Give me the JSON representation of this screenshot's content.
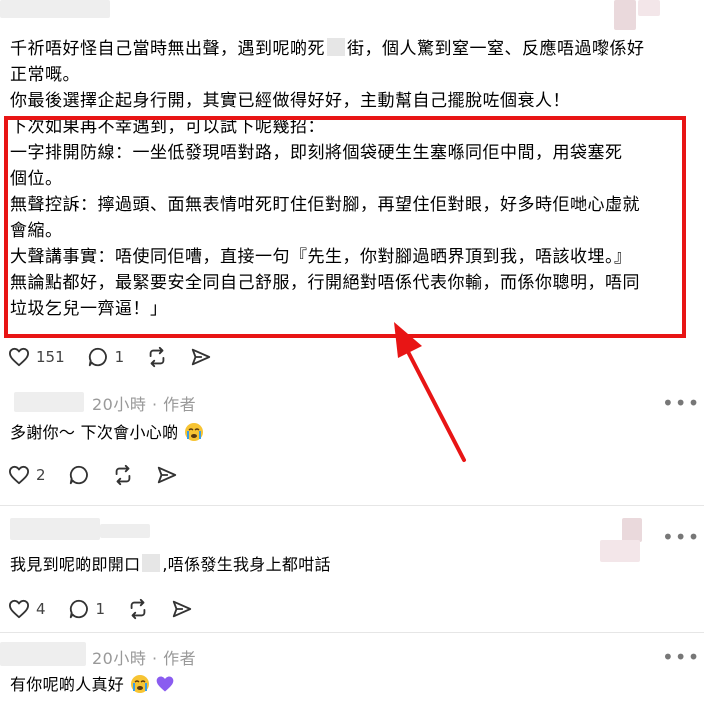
{
  "post": {
    "paragraph1": "千祈唔好怪自己當時無出聲，遇到呢啲死",
    "paragraph1b": "街，個人驚到窒一窒、反應唔過嚟係好",
    "paragraph1c": "正常嘅。",
    "paragraph2": "你最後選擇企起身行開，其實已經做得好好，主動幫自己擺脫咗個衰人！",
    "tips": [
      "下次如果再不幸遇到，可以試下呢幾招：",
      "一字排開防線：一坐低發現唔對路，即刻將個袋硬生生塞喺同佢中間，用袋塞死",
      "個位。",
      "無聲控訴：擰過頭、面無表情咁死盯住佢對腳，再望住佢對眼，好多時佢哋心虛就",
      "會縮。",
      "大聲講事實：唔使同佢嘈，直接一句『先生，你對腳過晒界頂到我，唔該收埋。』",
      "無論點都好，最緊要安全同自己舒服，行開絕對唔係代表你輸，而係你聰明，唔同",
      "垃圾乞兒一齊逼！」"
    ],
    "likes": "151",
    "replies": "1"
  },
  "comments": [
    {
      "time": "20小時",
      "author_tag": "作者",
      "text": "多謝你～ 下次會小心啲",
      "likes": "2",
      "replies": ""
    },
    {
      "time": "",
      "author_tag": "",
      "text_a": "我見到呢啲即開口",
      "text_b": ",唔係發生我身上都咁話",
      "likes": "4",
      "replies": "1"
    },
    {
      "time": "20小時",
      "author_tag": "作者",
      "text": "有你呢啲人真好"
    }
  ],
  "separator": "·",
  "more_label": "•••",
  "colors": {
    "highlight_border": "#e81515",
    "arrow": "#e81515",
    "heart_purple": "#8a5cf0"
  }
}
